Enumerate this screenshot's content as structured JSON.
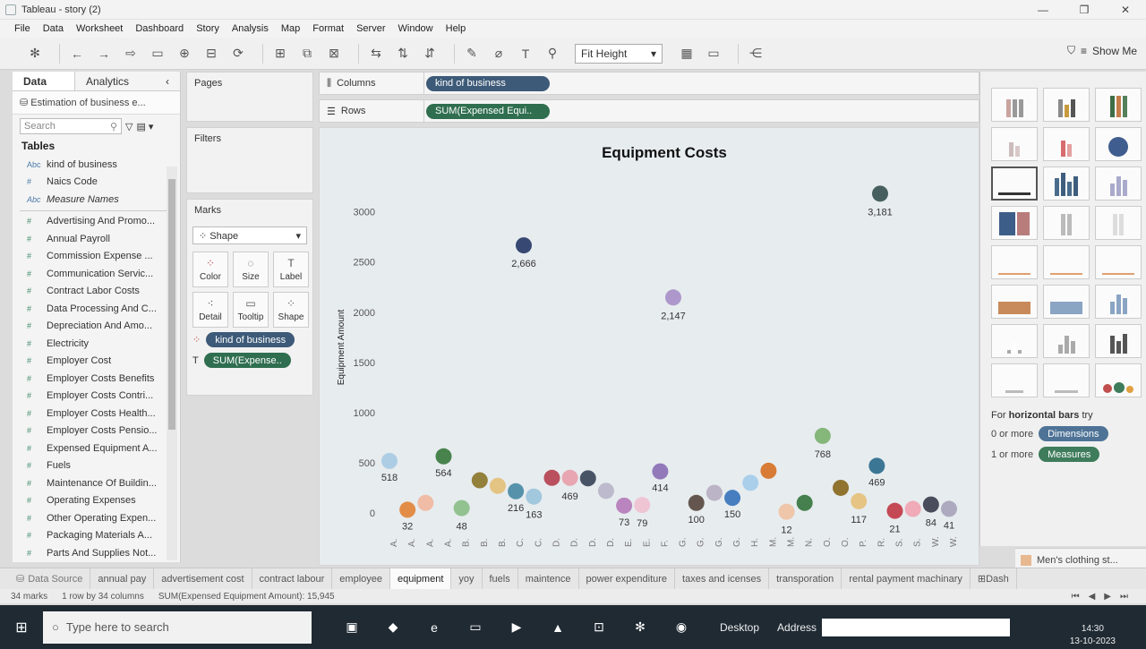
{
  "window": {
    "title": "Tableau - story (2)",
    "controls": [
      "—",
      "❐",
      "✕"
    ]
  },
  "menu": [
    "File",
    "Data",
    "Worksheet",
    "Dashboard",
    "Story",
    "Analysis",
    "Map",
    "Format",
    "Server",
    "Window",
    "Help"
  ],
  "toolbar": {
    "fit_value": "Fit Height",
    "show_me_label": "Show Me"
  },
  "data_pane": {
    "tabs": [
      "Data",
      "Analytics"
    ],
    "data_source": "Estimation of business e...",
    "search_placeholder": "Search",
    "tables_heading": "Tables",
    "dimensions": [
      {
        "type": "Abc",
        "name": "kind of business"
      },
      {
        "type": "#",
        "name": "Naics Code"
      },
      {
        "type": "Abc",
        "name": "Measure Names"
      }
    ],
    "measures": [
      "Advertising And Promo...",
      "Annual Payroll",
      "Commission Expense ...",
      "Communication Servic...",
      "Contract Labor Costs",
      "Data Processing And C...",
      "Depreciation And Amo...",
      "Electricity",
      "Employer Cost",
      "Employer Costs Benefits",
      "Employer Costs Contri...",
      "Employer Costs Health...",
      "Employer Costs Pensio...",
      "Expensed Equipment A...",
      "Fuels",
      "Maintenance Of Buildin...",
      "Operating Expenses",
      "Other Operating Expen...",
      "Packaging Materials A...",
      "Parts And Supplies Not..."
    ]
  },
  "cards": {
    "pages": "Pages",
    "filters": "Filters",
    "marks": "Marks",
    "mark_type": "Shape",
    "mark_buttons": [
      {
        "label": "Color",
        "icon": "color-icon"
      },
      {
        "label": "Size",
        "icon": "size-icon"
      },
      {
        "label": "Label",
        "icon": "label-icon"
      },
      {
        "label": "Detail",
        "icon": "detail-icon"
      },
      {
        "label": "Tooltip",
        "icon": "tooltip-icon"
      },
      {
        "label": "Shape",
        "icon": "shape-icon"
      }
    ],
    "mark_pills": [
      "kind of business",
      "SUM(Expense.."
    ]
  },
  "shelves": {
    "columns_label": "Columns",
    "columns_pill": "kind of business",
    "rows_label": "Rows",
    "rows_pill": "SUM(Expensed Equi.."
  },
  "chart_data": {
    "type": "scatter",
    "title": "Equipment Costs",
    "ylabel": "Equipment Amount",
    "ylim": [
      0,
      3300
    ],
    "yticks": [
      0,
      500,
      1000,
      1500,
      2000,
      2500,
      3000
    ],
    "x_tick_labels": [
      "A",
      "A",
      "A",
      "A",
      "B",
      "B",
      "B",
      "C",
      "C",
      "D",
      "D",
      "D",
      "D",
      "E",
      "E",
      "F",
      "G",
      "G",
      "G",
      "G",
      "H",
      "M",
      "M",
      "N",
      "O",
      "O",
      "P",
      "R",
      "S",
      "S",
      "W",
      "W"
    ],
    "points": [
      {
        "value": 518,
        "color": "#a9cbe3",
        "label": "518"
      },
      {
        "value": 32,
        "color": "#e2883d",
        "label": "32"
      },
      {
        "value": 100,
        "color": "#f0b9a0",
        "label": ""
      },
      {
        "value": 564,
        "color": "#3f7d44",
        "label": "564"
      },
      {
        "value": 48,
        "color": "#8cc08a",
        "label": "48"
      },
      {
        "value": 325,
        "color": "#8e7a30",
        "label": ""
      },
      {
        "value": 270,
        "color": "#e3c27c",
        "label": ""
      },
      {
        "value": 216,
        "color": "#4e8ea6",
        "label": "216"
      },
      {
        "value": 163,
        "color": "#9ec6dc",
        "label": "163"
      },
      {
        "value": 350,
        "color": "#b74754",
        "label": ""
      },
      {
        "value": 350,
        "color": "#e7a2ad",
        "label": "469"
      },
      {
        "value": 345,
        "color": "#3f4b5e",
        "label": ""
      },
      {
        "value": 220,
        "color": "#b9b7c9",
        "label": ""
      },
      {
        "value": 73,
        "color": "#b780ba",
        "label": "73"
      },
      {
        "value": 79,
        "color": "#efc3d2",
        "label": "79"
      },
      {
        "value": 414,
        "color": "#8d74b6",
        "label": "414"
      },
      {
        "value": 2147,
        "color": "#ab94c8",
        "label": "2,147"
      },
      {
        "value": 100,
        "color": "#5d4e45",
        "label": "100"
      },
      {
        "value": 200,
        "color": "#b8b0c3",
        "label": ""
      },
      {
        "value": 150,
        "color": "#3d78bd",
        "label": "150"
      },
      {
        "value": 300,
        "color": "#a6cdea",
        "label": ""
      },
      {
        "value": 420,
        "color": "#d6752b",
        "label": ""
      },
      {
        "value": 12,
        "color": "#efc4a4",
        "label": "12"
      },
      {
        "value": 100,
        "color": "#3c7a45",
        "label": ""
      },
      {
        "value": 768,
        "color": "#7fb373",
        "label": "768"
      },
      {
        "value": 250,
        "color": "#8b6d24",
        "label": ""
      },
      {
        "value": 117,
        "color": "#e6c27c",
        "label": "117"
      },
      {
        "value": 469,
        "color": "#33708f",
        "label": "469"
      },
      {
        "value": 21,
        "color": "#c2404b",
        "label": "21"
      },
      {
        "value": 40,
        "color": "#f1a6b4",
        "label": ""
      },
      {
        "value": 84,
        "color": "#404552",
        "label": "84"
      },
      {
        "value": 41,
        "color": "#aaa7bc",
        "label": "41"
      },
      {
        "value": 2666,
        "color": "#2d3f6c",
        "label": "2,666"
      },
      {
        "value": 3181,
        "color": "#3e5956",
        "label": "3,181"
      }
    ]
  },
  "show_me": {
    "hint_prefix": "For ",
    "hint_bold": "horizontal bars",
    "hint_suffix": " try",
    "dims_req": "0 or more",
    "dims_pill": "Dimensions",
    "meas_req": "1 or more",
    "meas_pill": "Measures",
    "legend_entry": "Men's clothing st..."
  },
  "sheet_tabs": {
    "data_source": "Data Source",
    "tabs": [
      "annual pay",
      "advertisement cost",
      "contract labour",
      "employee",
      "equipment",
      "yoy",
      "fuels",
      "maintence",
      "power expenditure",
      "taxes and icenses",
      "transporation",
      "rental payment machinary"
    ],
    "active": "equipment",
    "dash": "Dash"
  },
  "status": {
    "marks": "34 marks",
    "dims": "1 row by 34 columns",
    "sum": "SUM(Expensed Equipment Amount): 15,945"
  },
  "taskbar": {
    "search_placeholder": "Type here to search",
    "desktop": "Desktop",
    "address": "Address",
    "time": "14:30",
    "date": "13-10-2023"
  }
}
